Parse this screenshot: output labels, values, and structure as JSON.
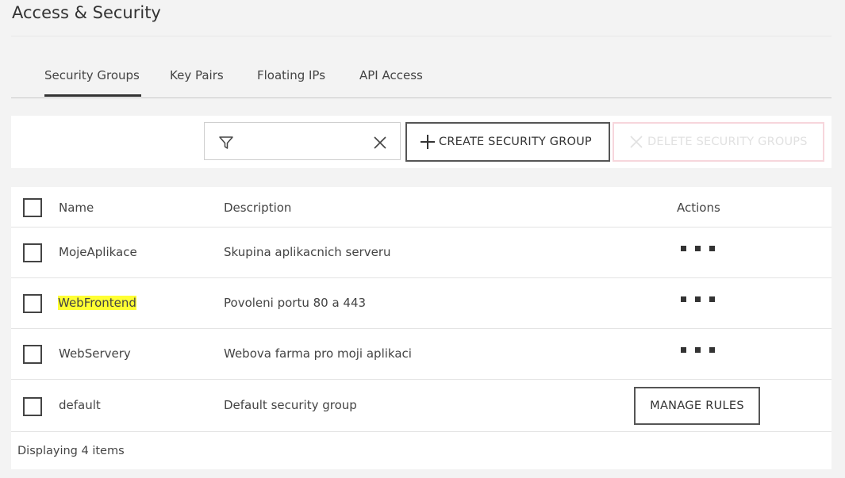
{
  "page": {
    "title": "Access & Security"
  },
  "tabs": [
    {
      "label": "Security Groups",
      "active": true
    },
    {
      "label": "Key Pairs",
      "active": false
    },
    {
      "label": "Floating IPs",
      "active": false
    },
    {
      "label": "API Access",
      "active": false
    }
  ],
  "toolbar": {
    "filter_value": "",
    "filter_icon": "filter-icon",
    "clear_icon": "close-icon",
    "create_label": "CREATE SECURITY GROUP",
    "delete_label": "DELETE SECURITY GROUPS"
  },
  "table": {
    "headers": {
      "name": "Name",
      "description": "Description",
      "actions": "Actions"
    },
    "rows": [
      {
        "name": "MojeAplikace",
        "description": "Skupina aplikacnich serveru",
        "action": "menu"
      },
      {
        "name": "WebFrontend",
        "description": "Povoleni portu 80 a 443",
        "action": "menu",
        "highlighted": true
      },
      {
        "name": "WebServery",
        "description": "Webova farma pro moji aplikaci",
        "action": "menu"
      },
      {
        "name": "default",
        "description": "Default security group",
        "action": "MANAGE RULES"
      }
    ],
    "footer": "Displaying 4 items"
  },
  "colors": {
    "highlight": "#ffff33",
    "delete_border": "#f7d6dc",
    "background": "#f3f3f3"
  }
}
